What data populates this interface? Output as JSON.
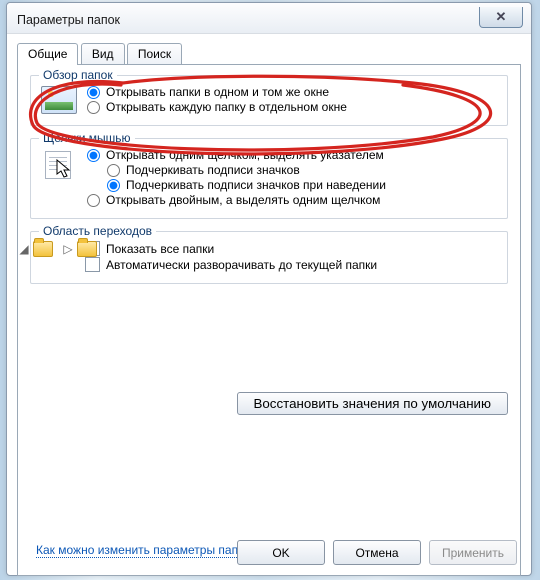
{
  "window": {
    "title": "Параметры папок"
  },
  "tabs": {
    "general": "Общие",
    "view": "Вид",
    "search": "Поиск"
  },
  "group_browse": {
    "legend": "Обзор папок",
    "opt_same": "Открывать папки в одном и том же окне",
    "opt_new": "Открывать каждую папку в отдельном окне"
  },
  "group_click": {
    "legend": "Щелчки мышью",
    "opt_single": "Открывать одним щелчком, выделять указателем",
    "opt_underline_always": "Подчеркивать подписи значков",
    "opt_underline_hover": "Подчеркивать подписи значков при наведении",
    "opt_double": "Открывать двойным, а выделять одним щелчком"
  },
  "group_nav": {
    "legend": "Область переходов",
    "chk_all": "Показать все папки",
    "chk_auto": "Автоматически разворачивать до текущей папки"
  },
  "buttons": {
    "restore": "Восстановить значения по умолчанию",
    "ok": "OK",
    "cancel": "Отмена",
    "apply": "Применить"
  },
  "help_link": "Как можно изменить параметры папок?"
}
